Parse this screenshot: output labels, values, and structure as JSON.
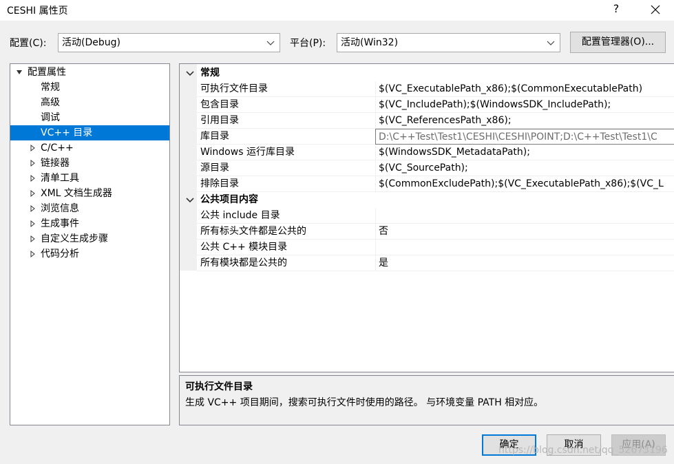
{
  "window": {
    "title": "CESHI 属性页",
    "help_glyph": "?"
  },
  "config_row": {
    "config_label": "配置(C):",
    "config_value": "活动(Debug)",
    "platform_label": "平台(P):",
    "platform_value": "活动(Win32)",
    "manager_button": "配置管理器(O)..."
  },
  "tree": {
    "root": "配置属性",
    "items": [
      {
        "label": "常规"
      },
      {
        "label": "高级"
      },
      {
        "label": "调试"
      },
      {
        "label": "VC++ 目录"
      },
      {
        "label": "C/C++"
      },
      {
        "label": "链接器"
      },
      {
        "label": "清单工具"
      },
      {
        "label": "XML 文档生成器"
      },
      {
        "label": "浏览信息"
      },
      {
        "label": "生成事件"
      },
      {
        "label": "自定义生成步骤"
      },
      {
        "label": "代码分析"
      }
    ]
  },
  "grid": {
    "categories": [
      {
        "label": "常规",
        "props": [
          {
            "name": "可执行文件目录",
            "value": "$(VC_ExecutablePath_x86);$(CommonExecutablePath)"
          },
          {
            "name": "包含目录",
            "value": "$(VC_IncludePath);$(WindowsSDK_IncludePath);"
          },
          {
            "name": "引用目录",
            "value": "$(VC_ReferencesPath_x86);"
          },
          {
            "name": "库目录",
            "value": "D:\\C++Test\\Test1\\CESHI\\CESHI\\POINT;D:\\C++Test\\Test1\\C"
          },
          {
            "name": "Windows 运行库目录",
            "value": "$(WindowsSDK_MetadataPath);"
          },
          {
            "name": "源目录",
            "value": "$(VC_SourcePath);"
          },
          {
            "name": "排除目录",
            "value": "$(CommonExcludePath);$(VC_ExecutablePath_x86);$(VC_L"
          }
        ]
      },
      {
        "label": "公共项目内容",
        "props": [
          {
            "name": "公共 include 目录",
            "value": ""
          },
          {
            "name": "所有标头文件都是公共的",
            "value": "否"
          },
          {
            "name": "公共 C++ 模块目录",
            "value": ""
          },
          {
            "name": "所有模块都是公共的",
            "value": "是"
          }
        ]
      }
    ]
  },
  "description": {
    "title": "可执行文件目录",
    "text": "生成 VC++ 项目期间，搜索可执行文件时使用的路径。 与环境变量 PATH 相对应。"
  },
  "buttons": {
    "ok": "确定",
    "cancel": "取消",
    "apply": "应用(A)"
  },
  "watermark": "https://blog.csdn.net/qq_52673196",
  "colors": {
    "selection": "#0078d7",
    "background": "#f0f0f0"
  }
}
